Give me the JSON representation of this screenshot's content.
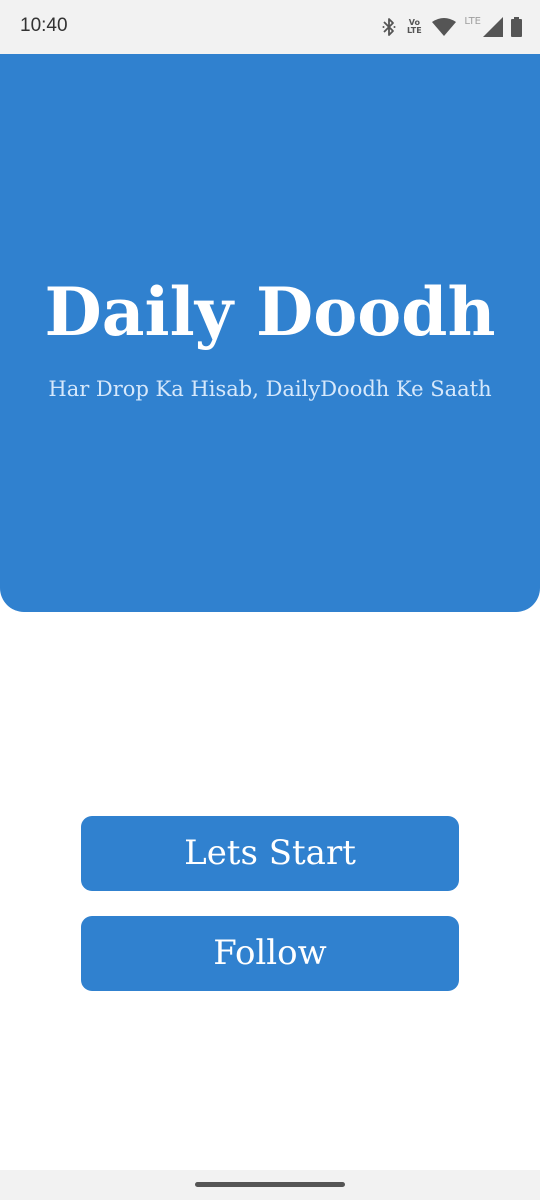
{
  "status_bar": {
    "time": "10:40",
    "volte_top": "Vo",
    "volte_bottom": "LTE",
    "network_label": "LTE",
    "icons": [
      "bluetooth-icon",
      "volte-icon",
      "wifi-icon",
      "signal-icon",
      "battery-icon"
    ]
  },
  "hero": {
    "title": "Daily Doodh",
    "subtitle": "Har Drop Ka Hisab, DailyDoodh Ke Saath",
    "background_color": "#3081cf"
  },
  "actions": {
    "start_label": "Lets Start",
    "follow_label": "Follow",
    "button_color": "#3081cf"
  }
}
